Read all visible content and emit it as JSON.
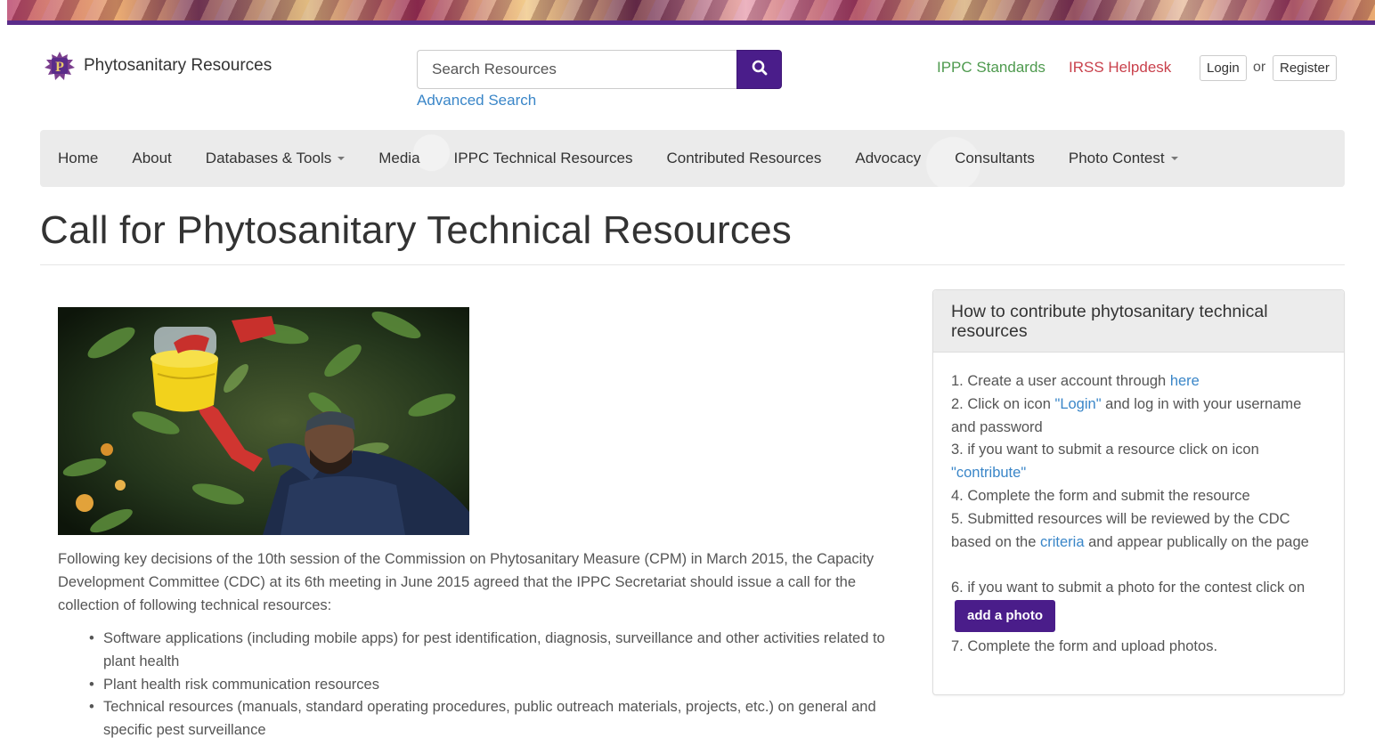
{
  "header": {
    "logo_text": "Phytosanitary Resources",
    "search_placeholder": "Search Resources",
    "advanced_search": "Advanced Search",
    "ippc_standards": "IPPC Standards",
    "irss_helpdesk": "IRSS Helpdesk",
    "login": "Login",
    "or": "or",
    "register": "Register"
  },
  "nav": {
    "items": [
      {
        "label": "Home"
      },
      {
        "label": "About"
      },
      {
        "label": "Databases & Tools"
      },
      {
        "label": "Media"
      },
      {
        "label": "IPPC Technical Resources"
      },
      {
        "label": "Contributed Resources"
      },
      {
        "label": "Advocacy"
      },
      {
        "label": "Consultants"
      },
      {
        "label": "Photo Contest"
      }
    ]
  },
  "page": {
    "title": "Call for Phytosanitary Technical Resources",
    "intro": "Following key decisions of the 10th session of the Commission on Phytosanitary Measure (CPM) in March 2015, the Capacity Development Committee (CDC) at its 6th meeting in June 2015 agreed that the IPPC Secretariat should issue a call for the collection of following technical resources:",
    "bullets": [
      "Software applications (including mobile apps) for pest identification, diagnosis, surveillance and other activities related to plant health",
      "Plant health risk communication resources",
      "Technical resources (manuals, standard operating procedures, public outreach materials, projects, etc.) on general and specific pest surveillance"
    ]
  },
  "panel": {
    "title": "How to contribute phytosanitary technical resources",
    "step1_text": "1. Create a user account through ",
    "step1_link": "here",
    "step2_text": "2. Click on icon ",
    "step2_link": "\"Login\"",
    "step2_rest": " and log in with your username and password",
    "step3_text": "3. if you want to submit a resource click on icon ",
    "step3_link": "\"contribute\"",
    "step4": "4. Complete the form and submit the resource",
    "step5_text": "5. Submitted resources will be reviewed by the CDC based on the ",
    "step5_link": "criteria",
    "step5_rest": " and appear publically on the page",
    "step6_text": "6. if you want to submit a photo for the contest click on",
    "step6_button": "add a photo",
    "step7": "7. Complete the form and upload photos."
  },
  "colors": {
    "brand_purple": "#4a1d8a",
    "link_blue": "#3a86c8",
    "ippc_green": "#4e9a4e",
    "irss_red": "#c9414c"
  }
}
